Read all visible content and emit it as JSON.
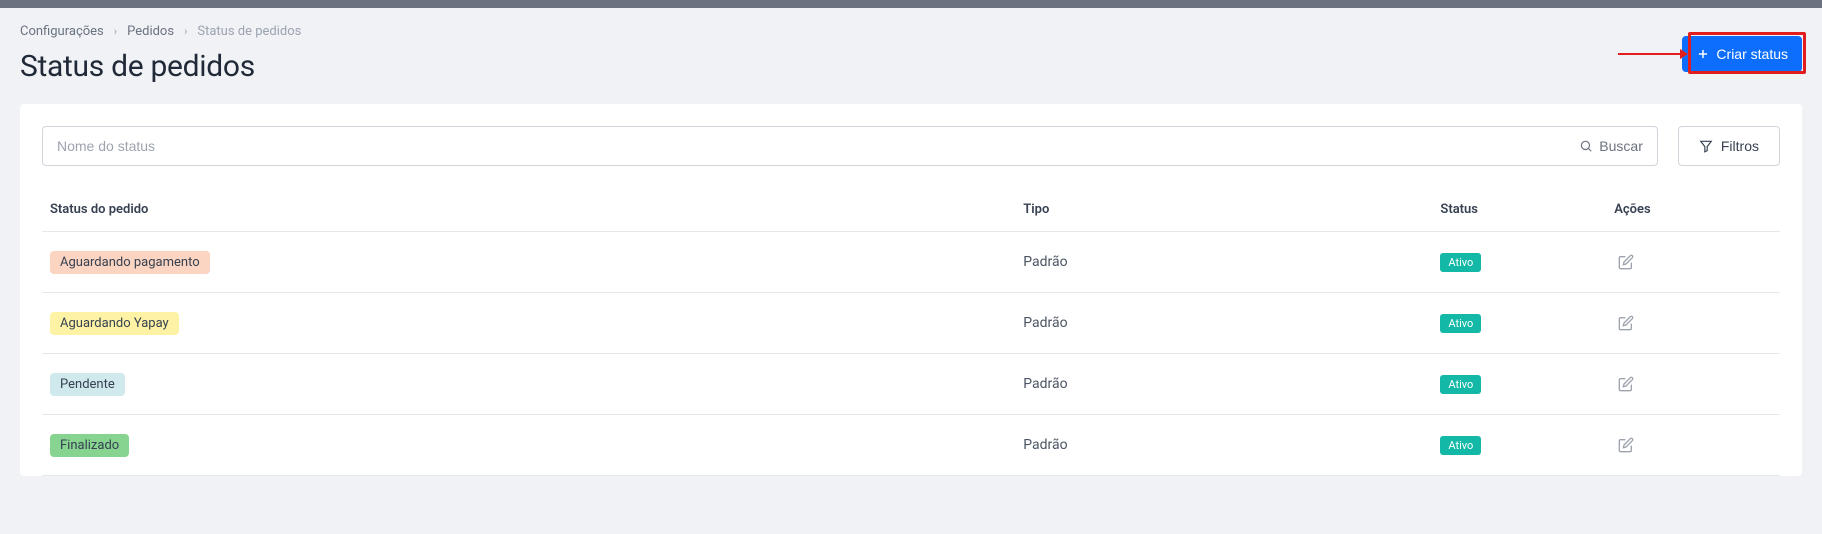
{
  "breadcrumb": {
    "item1": "Configurações",
    "item2": "Pedidos",
    "item3": "Status de pedidos"
  },
  "page_title": "Status de pedidos",
  "create_button": "Criar status",
  "search": {
    "placeholder": "Nome do status",
    "button": "Buscar"
  },
  "filters_button": "Filtros",
  "table": {
    "headers": {
      "status_name": "Status do pedido",
      "tipo": "Tipo",
      "status": "Status",
      "acoes": "Ações"
    },
    "rows": [
      {
        "name": "Aguardando pagamento",
        "tipo": "Padrão",
        "status": "Ativo",
        "color": "#fbd5c1"
      },
      {
        "name": "Aguardando Yapay",
        "tipo": "Padrão",
        "status": "Ativo",
        "color": "#fef3a5"
      },
      {
        "name": "Pendente",
        "tipo": "Padrão",
        "status": "Ativo",
        "color": "#cfe9ec"
      },
      {
        "name": "Finalizado",
        "tipo": "Padrão",
        "status": "Ativo",
        "color": "#86d48f"
      }
    ]
  }
}
